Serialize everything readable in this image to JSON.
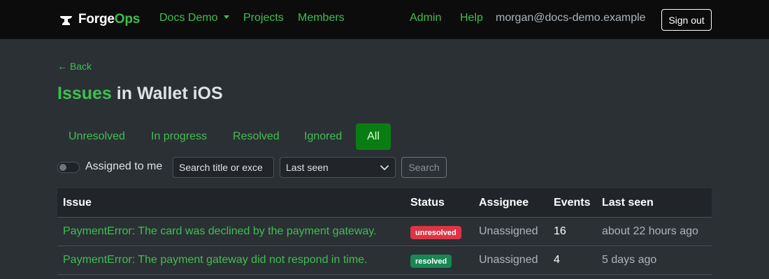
{
  "navbar": {
    "brand_main": "Forge",
    "brand_accent": "Ops",
    "project_menu": "Docs Demo",
    "projects_link": "Projects",
    "members_link": "Members",
    "admin_link": "Admin",
    "help_link": "Help",
    "user_email": "morgan@docs-demo.example",
    "signout_label": "Sign out"
  },
  "page": {
    "back_label": "← Back",
    "title_accent": "Issues",
    "title_rest": " in Wallet iOS"
  },
  "tabs": [
    {
      "label": "Unresolved",
      "active": false
    },
    {
      "label": "In progress",
      "active": false
    },
    {
      "label": "Resolved",
      "active": false
    },
    {
      "label": "Ignored",
      "active": false
    },
    {
      "label": "All",
      "active": true
    }
  ],
  "filters": {
    "assigned_label": "Assigned to me",
    "assigned_on": false,
    "search_placeholder": "Search title or exce",
    "sort_value": "Last seen",
    "search_button": "Search"
  },
  "table": {
    "headers": {
      "issue": "Issue",
      "status": "Status",
      "assignee": "Assignee",
      "events": "Events",
      "last_seen": "Last seen"
    },
    "rows": [
      {
        "issue": "PaymentError: The card was declined by the payment gateway.",
        "status": "unresolved",
        "status_color": "#dc3545",
        "assignee": "Unassigned",
        "events": "16",
        "last_seen": "about 22 hours ago"
      },
      {
        "issue": "PaymentError: The payment gateway did not respond in time.",
        "status": "resolved",
        "status_color": "#198754",
        "assignee": "Unassigned",
        "events": "4",
        "last_seen": "5 days ago"
      }
    ]
  },
  "colors": {
    "accent": "#3fbf4f",
    "active_tab": "#0a7d12",
    "navbar_bg": "#0c0c0c",
    "page_bg": "#2b3035"
  },
  "icons": {
    "brand": "anvil-icon",
    "dropdown": "caret-down-icon",
    "select": "chevron-down-icon"
  }
}
